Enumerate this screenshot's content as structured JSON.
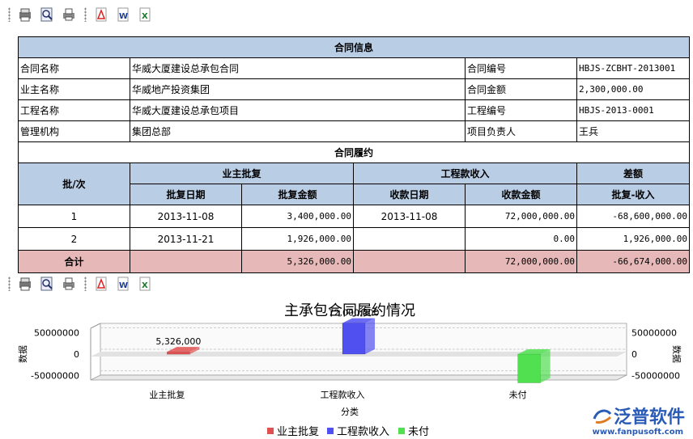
{
  "toolbar_icons": [
    "print-preview-icon",
    "zoom-icon",
    "print-icon",
    "export-pdf-icon",
    "export-word-icon",
    "export-excel-icon"
  ],
  "contract": {
    "title": "合同信息",
    "rows": [
      {
        "l1": "合同名称",
        "v1": "华威大厦建设总承包合同",
        "l2": "合同编号",
        "v2": "HBJS-ZCBHT-2013001"
      },
      {
        "l1": "业主名称",
        "v1": "华威地产投资集团",
        "l2": "合同金额",
        "v2": "2,300,000.00"
      },
      {
        "l1": "工程名称",
        "v1": "华威大厦建设总承包项目",
        "l2": "工程编号",
        "v2": "HBJS-2013-0001"
      },
      {
        "l1": "管理机构",
        "v1": "集团总部",
        "l2": "项目负责人",
        "v2": "王兵"
      }
    ]
  },
  "performance": {
    "title": "合同履约",
    "col_batch": "批/次",
    "group_owner": "业主批复",
    "group_income": "工程款收入",
    "group_diff": "差额",
    "col_approve_date": "批复日期",
    "col_approve_amount": "批复金额",
    "col_receive_date": "收款日期",
    "col_receive_amount": "收款金额",
    "col_diff": "批复-收入",
    "rows": [
      {
        "batch": "1",
        "approve_date": "2013-11-08",
        "approve_amount": "3,400,000.00",
        "receive_date": "2013-11-08",
        "receive_amount": "72,000,000.00",
        "diff": "-68,600,000.00"
      },
      {
        "batch": "2",
        "approve_date": "2013-11-21",
        "approve_amount": "1,926,000.00",
        "receive_date": "",
        "receive_amount": "0.00",
        "diff": "1,926,000.00"
      }
    ],
    "total": {
      "label": "合计",
      "approve_amount": "5,326,000.00",
      "receive_amount": "72,000,000.00",
      "diff": "-66,674,000.00"
    }
  },
  "chart_data": {
    "type": "bar",
    "title": "主承包合同履约情况",
    "xlabel": "分类",
    "ylabel": "数据",
    "ylabel_right": "数据",
    "categories": [
      "业主批复",
      "工程款收入",
      "未付"
    ],
    "values": [
      5326000,
      72000000,
      -66674000
    ],
    "data_labels": [
      "5,326,000",
      "72,000,000",
      ""
    ],
    "yticks": [
      50000000,
      0,
      -50000000
    ],
    "ytick_labels": [
      "50000000",
      "0",
      "-50000000"
    ],
    "ylim": [
      -60000000,
      60000000
    ],
    "colors": [
      "#e05050",
      "#5050f0",
      "#50e050"
    ],
    "legend": [
      "业主批复",
      "工程款收入",
      "未付"
    ],
    "legend_position": "bottom"
  },
  "brand": {
    "name": "泛普软件",
    "url": "www.fanpusoft.com"
  }
}
